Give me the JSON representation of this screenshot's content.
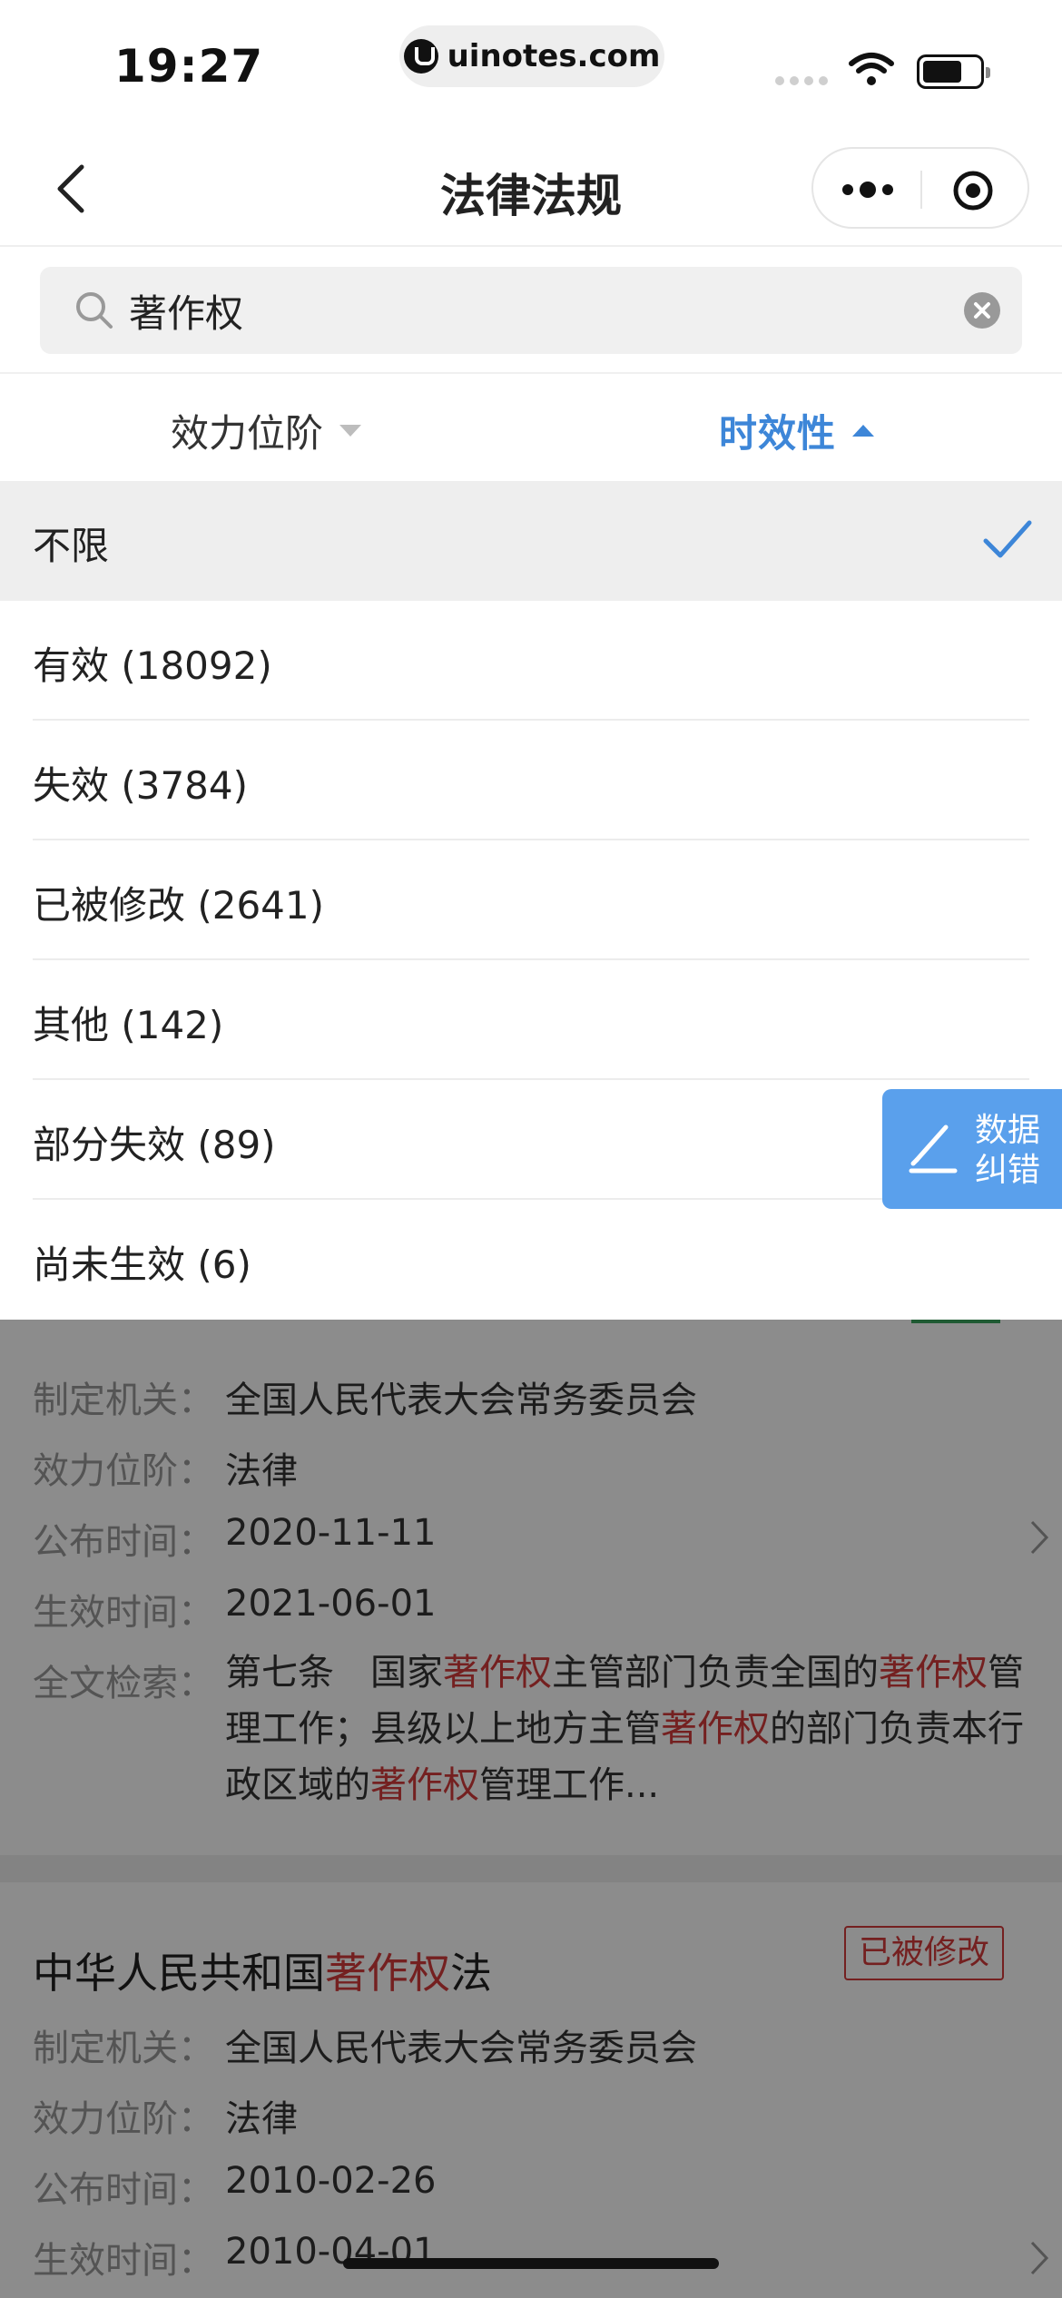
{
  "status_bar": {
    "time": "19:27",
    "url": "uinotes.com"
  },
  "nav": {
    "title": "法律法规",
    "back_icon": "chevron-left-icon",
    "more_icon": "more-dots-icon",
    "target_icon": "record-target-icon"
  },
  "search": {
    "value": "著作权",
    "placeholder": "著作权"
  },
  "filters": {
    "level_label": "效力位阶",
    "timeliness_label": "时效性",
    "active_color": "#3d86d8"
  },
  "dropdown": {
    "options": [
      {
        "label": "不限",
        "selected": true
      },
      {
        "label": "有效 (18092)"
      },
      {
        "label": "失效 (3784)"
      },
      {
        "label": "已被修改 (2641)"
      },
      {
        "label": "其他 (142)"
      },
      {
        "label": "部分失效 (89)"
      },
      {
        "label": "尚未生效 (6)"
      }
    ]
  },
  "float_button": {
    "line1": "数据",
    "line2": "纠错"
  },
  "results": {
    "card1": {
      "agency_key": "制定机关：",
      "agency": "全国人民代表大会常务委员会",
      "level_key": "效力位阶：",
      "level": "法律",
      "publish_key": "公布时间：",
      "publish": "2020-11-11",
      "effective_key": "生效时间：",
      "effective": "2021-06-01",
      "fulltext_key": "全文检索：",
      "fulltext_parts": [
        "第七条　国家",
        "著作权",
        "主管部门负责全国的",
        "著作权",
        "管理工作；县级以上地方主管",
        "著作权",
        "的部门负责本行政区域的",
        "著作权",
        "管理工作..."
      ]
    },
    "card2": {
      "title_prefix": "中华人民共和国",
      "title_highlight": "著作权",
      "title_suffix": "法",
      "badge": "已被修改",
      "agency_key": "制定机关：",
      "agency": "全国人民代表大会常务委员会",
      "level_key": "效力位阶：",
      "level": "法律",
      "publish_key": "公布时间：",
      "publish": "2010-02-26",
      "effective_key": "生效时间：",
      "effective": "2010-04-01"
    },
    "highlight_color": "#d43b3b"
  }
}
